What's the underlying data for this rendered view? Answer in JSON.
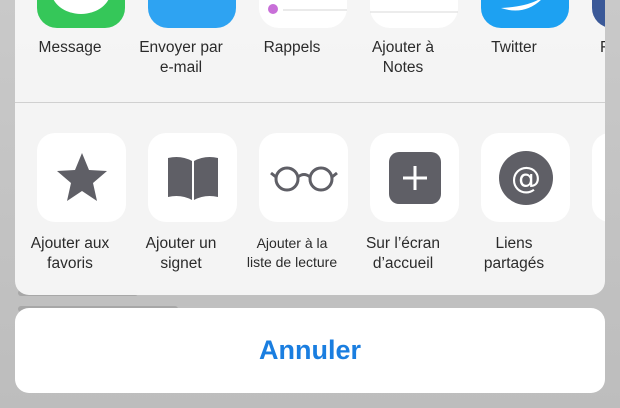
{
  "theme": {
    "accent": "#1a7ee0",
    "message_green": "#35c759",
    "mail_blue": "#2ea3f2",
    "twitter_blue": "#1da1f2",
    "icon_gray": "#5f5f66",
    "reminders_dot": "#c86fd8"
  },
  "apps": [
    {
      "id": "message",
      "label": "Message",
      "icon": "message-icon"
    },
    {
      "id": "mail",
      "label": "Envoyer par\ne-mail",
      "icon": "mail-icon"
    },
    {
      "id": "reminders",
      "label": "Rappels",
      "icon": "reminders-icon"
    },
    {
      "id": "notes",
      "label": "Ajouter à\nNotes",
      "icon": "notes-icon"
    },
    {
      "id": "twitter",
      "label": "Twitter",
      "icon": "twitter-icon"
    },
    {
      "id": "partial",
      "label": "F",
      "icon": "app-icon"
    }
  ],
  "actions": [
    {
      "id": "favorites",
      "label": "Ajouter aux\nfavoris",
      "icon": "star-icon"
    },
    {
      "id": "bookmark",
      "label": "Ajouter un\nsignet",
      "icon": "book-icon"
    },
    {
      "id": "reading-list",
      "label": "Ajouter à la\nliste de lecture",
      "icon": "glasses-icon"
    },
    {
      "id": "home-screen",
      "label": "Sur l’écran\nd’accueil",
      "icon": "plus-icon"
    },
    {
      "id": "shared-links",
      "label": "Liens\npartagés",
      "icon": "at-icon"
    }
  ],
  "cancel_label": "Annuler"
}
